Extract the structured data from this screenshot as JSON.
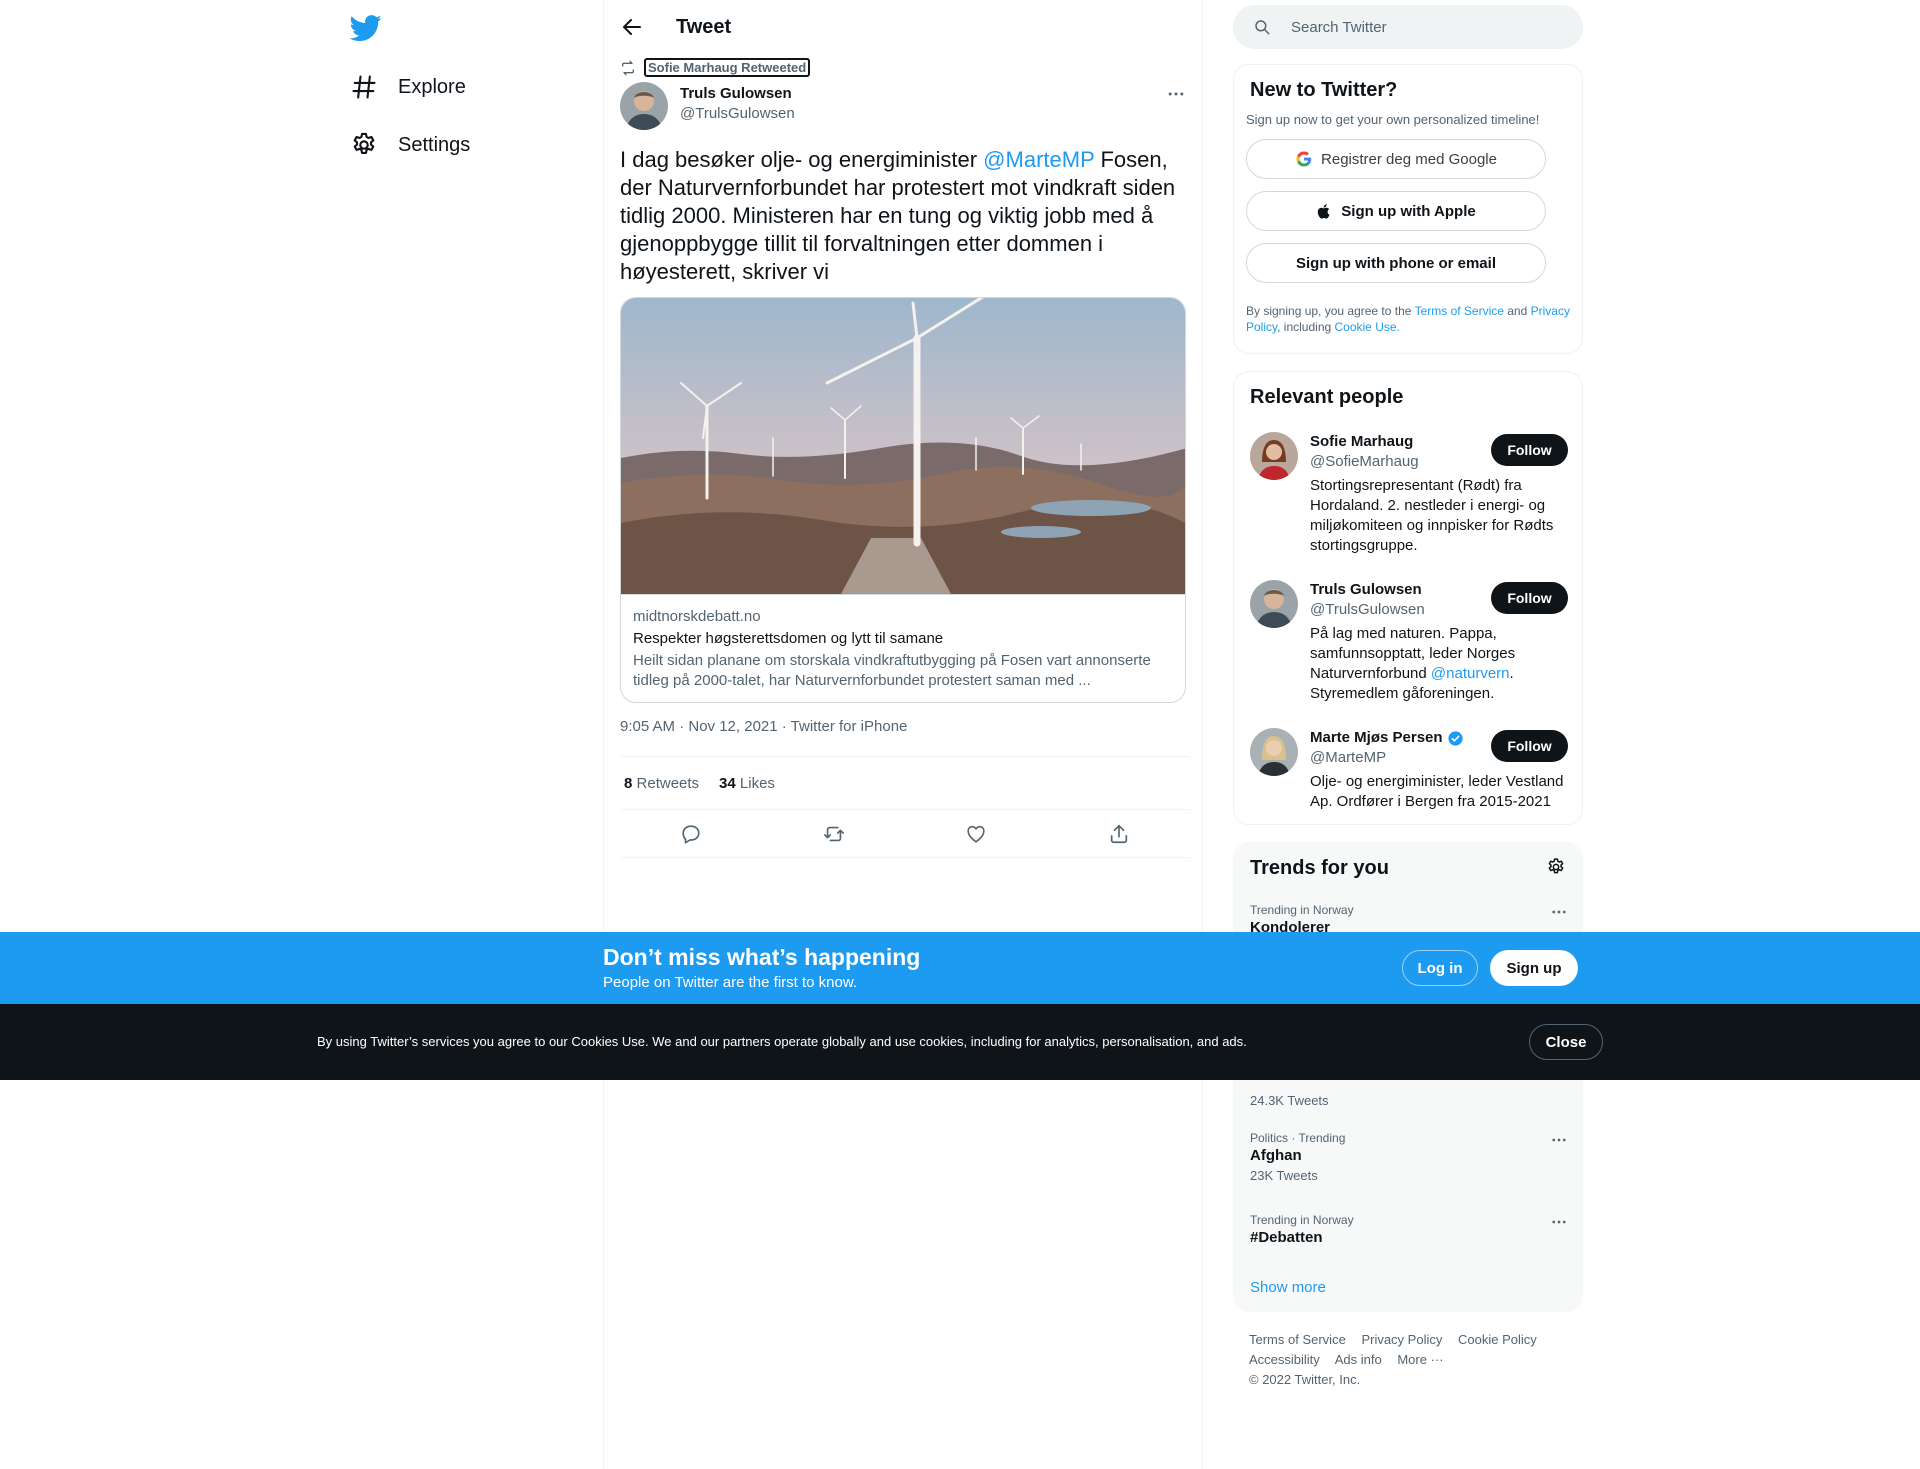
{
  "nav": {
    "explore_label": "Explore",
    "settings_label": "Settings"
  },
  "tweet": {
    "header_title": "Tweet",
    "retweeted_by": "Sofie Marhaug Retweeted",
    "author_name": "Truls Gulowsen",
    "author_handle": "@TrulsGulowsen",
    "text_before": "I dag besøker olje- og energiminister ",
    "mention": "@MarteMP",
    "text_after": " Fosen, der Naturvernforbundet har protestert mot vindkraft siden tidlig 2000. Ministeren har en tung og viktig jobb med å gjenoppbygge tillit til forvaltningen etter dommen i høyesterett, skriver vi",
    "card": {
      "domain": "midtnorskdebatt.no",
      "title": "Respekter høgsterettsdomen og lytt til samane",
      "description": "Heilt sidan planane om storskala vindkraftutbygging på Fosen vart annonserte tidleg på 2000-talet, har Naturvernforbundet protestert saman med ..."
    },
    "meta": "9:05 AM · Nov 12, 2021 · Twitter for iPhone",
    "retweets_count": "8",
    "retweets_label": "Retweets",
    "likes_count": "34",
    "likes_label": "Likes"
  },
  "search": {
    "placeholder": "Search Twitter"
  },
  "new_to_twitter": {
    "title": "New to Twitter?",
    "subtitle": "Sign up now to get your own personalized timeline!",
    "google_label": "Registrer deg med Google",
    "apple_label": "Sign up with Apple",
    "phone_label": "Sign up with phone or email",
    "terms_prefix": "By signing up, you agree to the ",
    "terms_link": "Terms of Service",
    "terms_and": " and ",
    "privacy_link": "Privacy Policy",
    "including": ", including ",
    "cookie_link": "Cookie Use."
  },
  "relevant_people": {
    "title": "Relevant people",
    "follow_label": "Follow",
    "people": [
      {
        "name": "Sofie Marhaug",
        "handle": "@SofieMarhaug",
        "bio": "Stortingsrepresentant (Rødt) fra Hordaland. 2. nestleder i energi- og miljøkomiteen og innpisker for Rødts stortingsgruppe."
      },
      {
        "name": "Truls Gulowsen",
        "handle": "@TrulsGulowsen",
        "bio_before": "På lag med naturen. Pappa, samfunnsopptatt, leder Norges Naturvernforbund ",
        "bio_link": "@naturvern",
        "bio_after": ". Styremedlem gåforeningen."
      },
      {
        "name": "Marte Mjøs Persen",
        "handle": "@MarteMP",
        "bio": "Olje- og energiminister, leder Vestland Ap. Ordfører i Bergen fra 2015-2021"
      }
    ]
  },
  "trends": {
    "title": "Trends for you",
    "items": [
      {
        "context": "Trending in Norway",
        "name": "Kondolerer",
        "count": ""
      },
      {
        "context": "",
        "name": "",
        "count": "24.3K Tweets"
      },
      {
        "context": "Politics · Trending",
        "name": "Afghan",
        "count": "23K Tweets"
      },
      {
        "context": "Trending in Norway",
        "name": "#Debatten",
        "count": ""
      }
    ],
    "show_more": "Show more"
  },
  "footer": {
    "links": [
      "Terms of Service",
      "Privacy Policy",
      "Cookie Policy",
      "Accessibility",
      "Ads info",
      "More ···"
    ],
    "copyright": "© 2022 Twitter, Inc."
  },
  "signup_bar": {
    "headline": "Don’t miss what’s happening",
    "subline": "People on Twitter are the first to know.",
    "login_label": "Log in",
    "signup_label": "Sign up"
  },
  "cookie_bar": {
    "text": "By using Twitter’s services you agree to our Cookies Use. We and our partners operate globally and use cookies, including for analytics, personalisation, and ads.",
    "close_label": "Close"
  },
  "colors": {
    "accent": "#1d9bf0",
    "text": "#0f1419",
    "muted": "#536471",
    "cookie_bar": "#0f1419"
  },
  "icons": [
    "twitter-bird-icon",
    "hashtag-icon",
    "gear-icon",
    "back-arrow-icon",
    "retweet-icon",
    "more-icon",
    "reply-icon",
    "like-icon",
    "share-icon",
    "search-icon",
    "google-icon",
    "apple-icon",
    "verified-icon"
  ]
}
